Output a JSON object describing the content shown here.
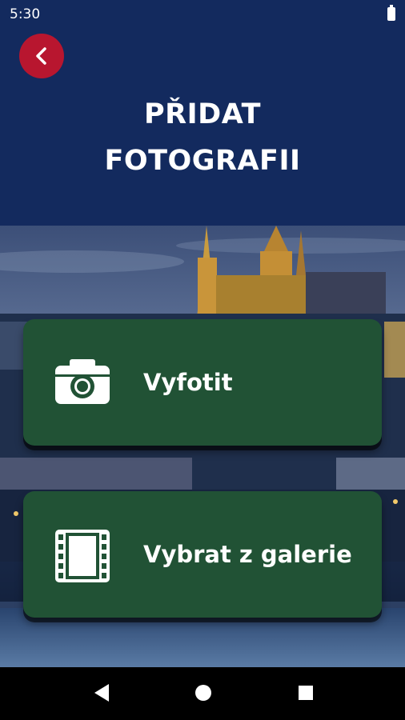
{
  "status_bar": {
    "time": "5:30"
  },
  "header": {
    "title_line1": "PŘIDAT",
    "title_line2": "FOTOGRAFII"
  },
  "actions": [
    {
      "label": "Vyfotit",
      "icon": "camera-icon"
    },
    {
      "label": "Vybrat z galerie",
      "icon": "film-icon"
    }
  ],
  "colors": {
    "header_bg": "#132a5e",
    "back_button": "#b8162f",
    "card_bg": "#215235",
    "text": "#ffffff"
  }
}
